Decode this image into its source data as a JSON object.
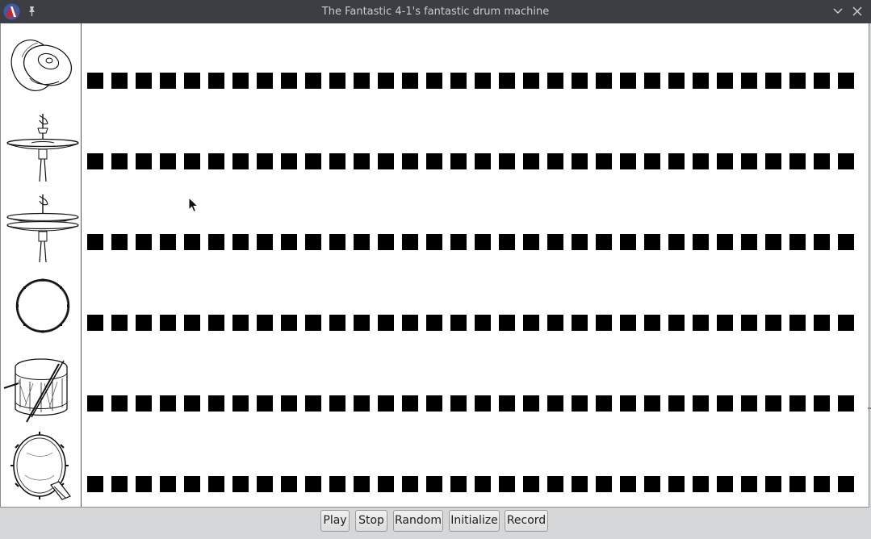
{
  "window": {
    "title": "The Fantastic 4-1's fantastic drum machine",
    "app_icon": "racket-logo-icon",
    "pin_icon": "pin-icon",
    "minimize_icon": "chevron-down-icon",
    "close_icon": "close-icon"
  },
  "instruments": [
    {
      "name": "crash cymbal",
      "icon": "crash-cymbal-icon"
    },
    {
      "name": "hi-hat closed",
      "icon": "hihat-closed-icon"
    },
    {
      "name": "hi-hat open",
      "icon": "hihat-open-icon"
    },
    {
      "name": "tom",
      "icon": "tom-drum-icon"
    },
    {
      "name": "snare drum",
      "icon": "snare-drum-icon"
    },
    {
      "name": "bass drum",
      "icon": "bass-drum-icon"
    }
  ],
  "steps_per_row": 32,
  "buttons": {
    "play": "Play",
    "stop": "Stop",
    "random": "Random",
    "initialize": "Initialize",
    "record": "Record"
  }
}
